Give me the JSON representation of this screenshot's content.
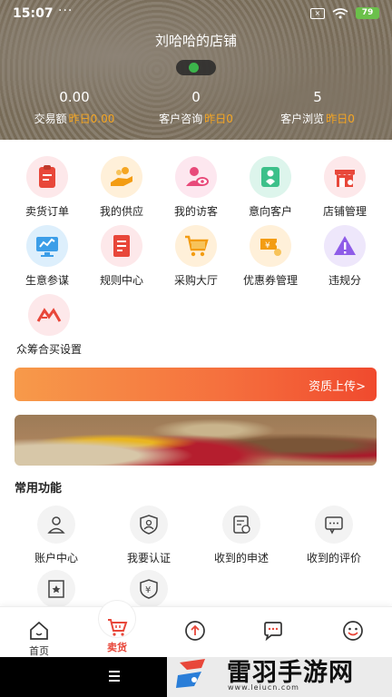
{
  "status_bar": {
    "time": "15:07",
    "dots": "···",
    "battery": "79"
  },
  "header": {
    "shop_name": "刘哈哈的店铺",
    "stats": [
      {
        "value": "0.00",
        "label": "交易额",
        "sub": "昨日0.00"
      },
      {
        "value": "0",
        "label": "客户咨询",
        "sub": "昨日0"
      },
      {
        "value": "5",
        "label": "客户浏览",
        "sub": "昨日0"
      }
    ]
  },
  "grid": [
    {
      "label": "卖货订单",
      "icon": "clipboard-icon"
    },
    {
      "label": "我的供应",
      "icon": "hand-coins-icon"
    },
    {
      "label": "我的访客",
      "icon": "visitor-eye-icon"
    },
    {
      "label": "意向客户",
      "icon": "heart-user-icon"
    },
    {
      "label": "店铺管理",
      "icon": "store-gear-icon"
    },
    {
      "label": "生意参谋",
      "icon": "monitor-chart-icon"
    },
    {
      "label": "规则中心",
      "icon": "document-list-icon"
    },
    {
      "label": "采购大厅",
      "icon": "shopping-cart-icon"
    },
    {
      "label": "优惠券管理",
      "icon": "coupon-icon"
    },
    {
      "label": "违规分",
      "icon": "warning-triangle-icon"
    },
    {
      "label": "众筹合买设置",
      "icon": "crowdfunding-icon"
    }
  ],
  "cert_banner": {
    "text": "资质上传>"
  },
  "common_section": {
    "title": "常用功能",
    "items": [
      {
        "label": "账户中心",
        "icon": "user-icon"
      },
      {
        "label": "我要认证",
        "icon": "shield-user-icon"
      },
      {
        "label": "收到的申述",
        "icon": "appeal-document-icon"
      },
      {
        "label": "收到的评价",
        "icon": "chat-bubble-icon"
      },
      {
        "label": "",
        "icon": "star-bookmark-icon"
      },
      {
        "label": "",
        "icon": "yen-shield-icon"
      }
    ]
  },
  "bottom_nav": [
    {
      "label": "首页",
      "icon": "home-icon"
    },
    {
      "label": "卖货",
      "icon": "cart-icon",
      "active": true
    },
    {
      "label": "",
      "icon": "upload-icon"
    },
    {
      "label": "",
      "icon": "message-icon"
    },
    {
      "label": "",
      "icon": "smiley-icon"
    }
  ],
  "watermark": {
    "title": "雷羽手游网",
    "url": "www.leiucn.com"
  },
  "colors": {
    "accent": "#e8473a",
    "banner_start": "#f79a4a",
    "banner_end": "#f04a2e",
    "stat_sub": "#f5a623"
  }
}
